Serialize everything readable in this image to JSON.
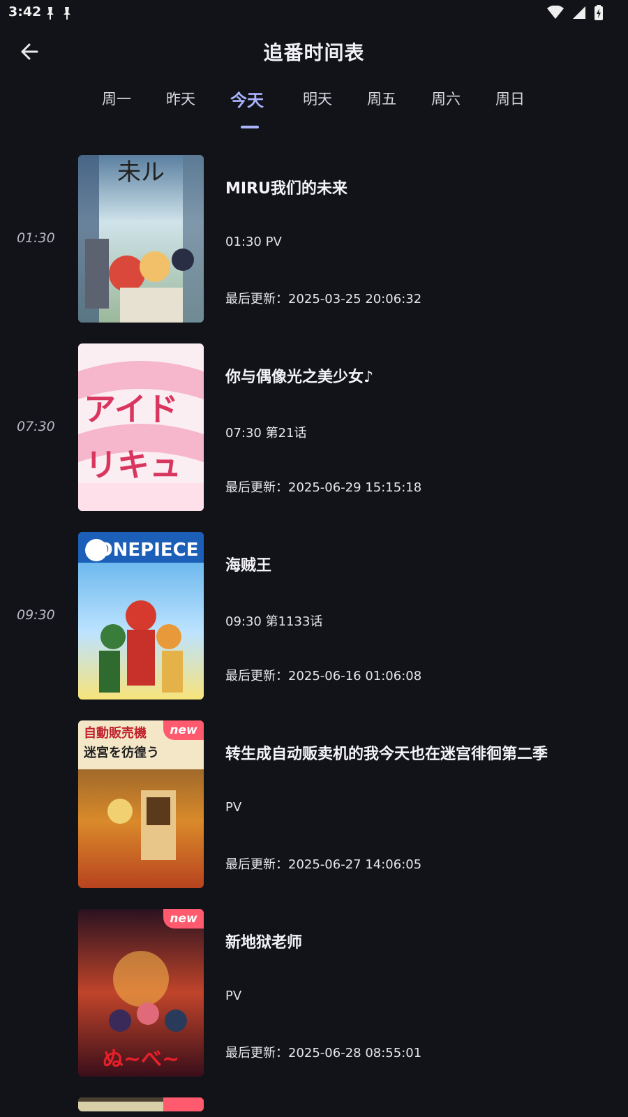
{
  "status_bar": {
    "time": "3:42",
    "left_icons": [
      "notification-icon",
      "notification-icon"
    ],
    "right_icons": [
      "wifi-icon",
      "signal-icon",
      "battery-icon"
    ]
  },
  "app_bar": {
    "back_icon": "arrow-back-icon",
    "title": "追番时间表"
  },
  "tabs": [
    {
      "label": "周一",
      "active": false
    },
    {
      "label": "昨天",
      "active": false
    },
    {
      "label": "今天",
      "active": true
    },
    {
      "label": "明天",
      "active": false
    },
    {
      "label": "周五",
      "active": false
    },
    {
      "label": "周六",
      "active": false
    },
    {
      "label": "周日",
      "active": false
    }
  ],
  "accent_color": "#a9b3ff",
  "badge_color": "#ff5a6e",
  "schedule": [
    {
      "time": "01:30",
      "title": "MIRU我们的未来",
      "episode": " 01:30 PV",
      "updated": "最后更新：2025-03-25 20:06:32",
      "badge": ""
    },
    {
      "time": "07:30",
      "title": "你与偶像光之美少女♪",
      "episode": "07:30 第21话",
      "updated": "最后更新：2025-06-29 15:15:18",
      "badge": ""
    },
    {
      "time": "09:30",
      "title": "海贼王",
      "episode": "09:30 第1133话",
      "updated": "最后更新：2025-06-16 01:06:08",
      "badge": ""
    },
    {
      "time": "",
      "title": "转生成自动贩卖机的我今天也在迷宫徘徊第二季",
      "episode": "PV",
      "updated": "最后更新：2025-06-27 14:06:05",
      "badge": "new"
    },
    {
      "time": "",
      "title": "新地狱老师",
      "episode": "PV",
      "updated": "最后更新：2025-06-28 08:55:01",
      "badge": "new"
    }
  ]
}
